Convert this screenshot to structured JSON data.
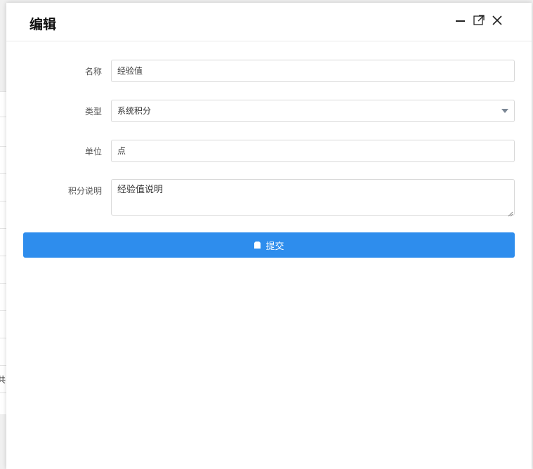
{
  "dialog": {
    "title": "编辑"
  },
  "form": {
    "name": {
      "label": "名称",
      "value": "经验值"
    },
    "type": {
      "label": "类型",
      "value": "系统积分"
    },
    "unit": {
      "label": "单位",
      "value": "点"
    },
    "description": {
      "label": "积分说明",
      "value": "经验值说明"
    }
  },
  "actions": {
    "submit_label": "提交"
  },
  "background": {
    "partial_text": "共"
  },
  "colors": {
    "primary": "#2e8ded",
    "border": "#d8d8d8",
    "label": "#555555"
  },
  "icons": {
    "minimize": "minimize-icon",
    "maximize": "maximize-icon",
    "close": "close-icon",
    "dropdown": "chevron-down-icon",
    "submit": "save-icon"
  }
}
